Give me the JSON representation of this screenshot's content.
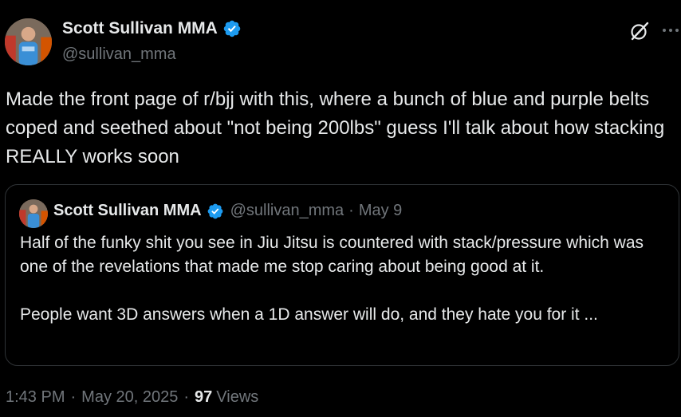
{
  "author": {
    "name": "Scott Sullivan MMA",
    "handle": "@sullivan_mma",
    "verified": true
  },
  "tweet": {
    "text": "Made the front page of r/bjj with this, where a bunch of blue and purple belts coped and seethed about \"not being 200lbs\" guess I'll talk about how stacking REALLY works soon"
  },
  "quoted": {
    "name": "Scott Sullivan MMA",
    "handle": "@sullivan_mma",
    "separator": "·",
    "date": "May 9",
    "paragraphs": [
      "Half of the funky shit you see in Jiu Jitsu is countered with stack/pressure which was one of the revelations that made me stop caring about being good at it.",
      "People want 3D answers when a 1D answer will do, and they hate you for it ..."
    ]
  },
  "meta": {
    "time": "1:43 PM",
    "separator": "·",
    "date": "May 20, 2025",
    "views_count": "97",
    "views_label": "Views"
  },
  "icons": {
    "more": "more-icon",
    "grok": "grok-icon",
    "verified": "verified-badge-icon"
  },
  "colors": {
    "background": "#000000",
    "text": "#e7e9ea",
    "secondary": "#71767b",
    "verified": "#1d9bf0",
    "border": "#2f3336"
  }
}
